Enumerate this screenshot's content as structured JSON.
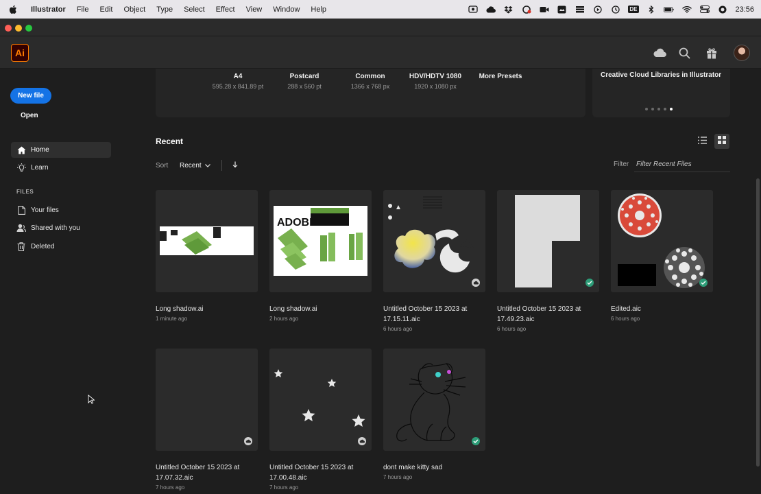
{
  "menubar": {
    "app_name": "Illustrator",
    "items": [
      "File",
      "Edit",
      "Object",
      "Type",
      "Select",
      "Effect",
      "View",
      "Window",
      "Help"
    ],
    "input_source": "DE",
    "clock": "23:56"
  },
  "sidebar": {
    "new_file": "New file",
    "open": "Open",
    "nav": [
      {
        "label": "Home",
        "icon": "home-icon"
      },
      {
        "label": "Learn",
        "icon": "lightbulb-icon"
      }
    ],
    "files_heading": "FILES",
    "files": [
      {
        "label": "Your files",
        "icon": "document-icon"
      },
      {
        "label": "Shared with you",
        "icon": "shared-user-icon"
      },
      {
        "label": "Deleted",
        "icon": "trash-icon"
      }
    ]
  },
  "header": {
    "logo_text": "Ai"
  },
  "presets": [
    {
      "name": "A4",
      "size": "595.28 x 841.89 pt"
    },
    {
      "name": "Postcard",
      "size": "288 x 560 pt"
    },
    {
      "name": "Common",
      "size": "1366 x 768 px"
    },
    {
      "name": "HDV/HDTV 1080",
      "size": "1920 x 1080 px"
    },
    {
      "name": "More Presets",
      "size": ""
    }
  ],
  "promo": {
    "title": "Creative Cloud Libraries in Illustrator"
  },
  "recent": {
    "title": "Recent",
    "sort_label": "Sort",
    "sort_value": "Recent",
    "filter_label": "Filter",
    "filter_placeholder": "Filter Recent Files",
    "files": [
      {
        "name": "Long shadow.ai",
        "time": "1 minute ago",
        "status": "none"
      },
      {
        "name": "Long shadow.ai",
        "time": "2 hours ago",
        "status": "none"
      },
      {
        "name": "Untitled October 15 2023 at 17.15.11.aic",
        "time": "6 hours ago",
        "status": "cloud"
      },
      {
        "name": "Untitled October 15 2023 at 17.49.23.aic",
        "time": "6 hours ago",
        "status": "synced"
      },
      {
        "name": "Edited.aic",
        "time": "6 hours ago",
        "status": "synced"
      },
      {
        "name": "Untitled October 15 2023 at 17.07.32.aic",
        "time": "7 hours ago",
        "status": "cloud"
      },
      {
        "name": "Untitled October 15 2023 at 17.00.48.aic",
        "time": "7 hours ago",
        "status": "cloud"
      },
      {
        "name": "dont make kitty sad",
        "time": "7 hours ago",
        "status": "synced"
      }
    ]
  },
  "colors": {
    "accent": "#1473e6",
    "ai_orange": "#ff7c00",
    "synced_green": "#2d9d78"
  }
}
